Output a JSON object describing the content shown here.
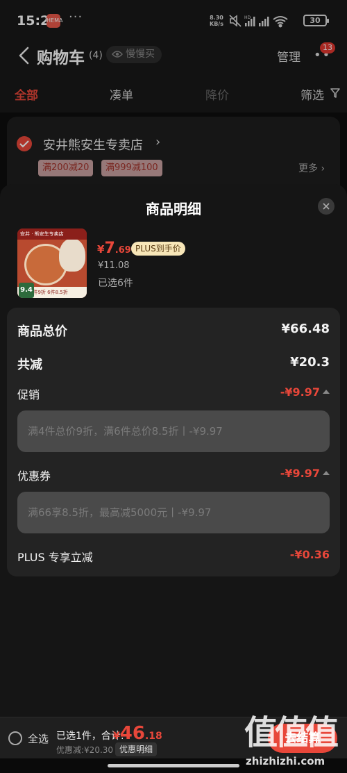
{
  "status_bar": {
    "time": "15:29",
    "app_icon_text": "HEMA",
    "more": "···",
    "speed_value": "8.30",
    "speed_unit": "KB/s",
    "battery": "30"
  },
  "nav": {
    "title": "购物车",
    "count": "(4)",
    "slow_buy": "慢慢买",
    "manage": "管理",
    "more_badge": "13"
  },
  "tabs": [
    {
      "label": "全部"
    },
    {
      "label": "凑单"
    },
    {
      "label": "降价"
    },
    {
      "label": "筛选"
    }
  ],
  "store": {
    "name": "安井熊安生专卖店",
    "coupons": [
      "满200减20",
      "满999减100"
    ],
    "more": "更多"
  },
  "sheet": {
    "title": "商品明细",
    "product": {
      "thumb_header": "安井 · 熊安生专卖店",
      "thumb_footer": "4件9折 6件8.5折",
      "thumb_rank": "9.4",
      "price_symbol": "¥",
      "price_int": "7",
      "price_dec": ".69",
      "plus_tag": "PLUS到手价",
      "original_price": "¥11.08",
      "selected": "已选6件"
    },
    "rows": {
      "total_label": "商品总价",
      "total_value": "¥66.48",
      "reduce_label": "共减",
      "reduce_value": "¥20.3",
      "promo_label": "促销",
      "promo_value": "-¥9.97",
      "promo_detail": "满4件总价9折，满6件总价8.5折丨-¥9.97",
      "coupon_label": "优惠券",
      "coupon_value": "-¥9.97",
      "coupon_detail": "满66享8.5折，最高减5000元丨-¥9.97",
      "plus_label": "PLUS 专享立减",
      "plus_value": "-¥0.36"
    }
  },
  "bottom": {
    "select_all": "全选",
    "summary": "已选1件，合计:",
    "total_symbol": "¥",
    "total_int": "46",
    "total_dec": ".18",
    "discount": "优惠减:¥20.30",
    "detail_button": "优惠明细",
    "checkout": "去结算"
  },
  "watermark": {
    "big": "值值值",
    "url": "zhizhizhi.com"
  },
  "colors": {
    "accent": "#e8473a",
    "background": "#0e0e0e",
    "panel": "#232323"
  }
}
